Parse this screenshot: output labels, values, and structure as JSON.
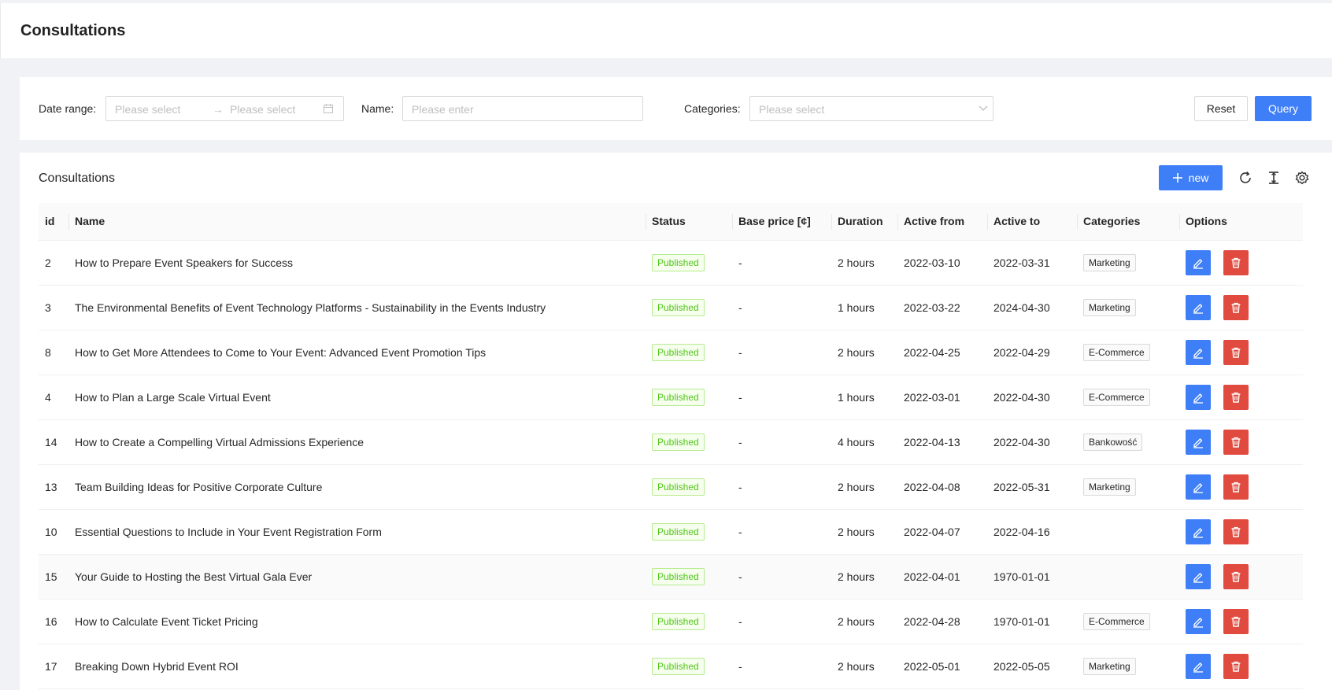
{
  "page": {
    "title": "Consultations"
  },
  "filters": {
    "date_label": "Date range",
    "date_start_placeholder": "Please select",
    "date_end_placeholder": "Please select",
    "name_label": "Name",
    "name_placeholder": "Please enter",
    "categories_label": "Categories",
    "categories_placeholder": "Please select",
    "reset_label": "Reset",
    "query_label": "Query"
  },
  "table": {
    "title": "Consultations",
    "new_label": "new",
    "columns": [
      "id",
      "Name",
      "Status",
      "Base price [¢]",
      "Duration",
      "Active from",
      "Active to",
      "Categories",
      "Options"
    ],
    "rows": [
      {
        "id": "2",
        "name": "How to Prepare Event Speakers for Success",
        "status": "Published",
        "price": "-",
        "duration": "2 hours",
        "from": "2022-03-10",
        "to": "2022-03-31",
        "category": "Marketing"
      },
      {
        "id": "3",
        "name": "The Environmental Benefits of Event Technology Platforms - Sustainability in the Events Industry",
        "status": "Published",
        "price": "-",
        "duration": "1 hours",
        "from": "2022-03-22",
        "to": "2024-04-30",
        "category": "Marketing"
      },
      {
        "id": "8",
        "name": "How to Get More Attendees to Come to Your Event: Advanced Event Promotion Tips",
        "status": "Published",
        "price": "-",
        "duration": "2 hours",
        "from": "2022-04-25",
        "to": "2022-04-29",
        "category": "E-Commerce"
      },
      {
        "id": "4",
        "name": "How to Plan a Large Scale Virtual Event",
        "status": "Published",
        "price": "-",
        "duration": "1 hours",
        "from": "2022-03-01",
        "to": "2022-04-30",
        "category": "E-Commerce"
      },
      {
        "id": "14",
        "name": "How to Create a Compelling Virtual Admissions Experience",
        "status": "Published",
        "price": "-",
        "duration": "4 hours",
        "from": "2022-04-13",
        "to": "2022-04-30",
        "category": "Bankowość"
      },
      {
        "id": "13",
        "name": "Team Building Ideas for Positive Corporate Culture",
        "status": "Published",
        "price": "-",
        "duration": "2 hours",
        "from": "2022-04-08",
        "to": "2022-05-31",
        "category": "Marketing"
      },
      {
        "id": "10",
        "name": "Essential Questions to Include in Your Event Registration Form",
        "status": "Published",
        "price": "-",
        "duration": "2 hours",
        "from": "2022-04-07",
        "to": "2022-04-16",
        "category": ""
      },
      {
        "id": "15",
        "name": "Your Guide to Hosting the Best Virtual Gala Ever",
        "status": "Published",
        "price": "-",
        "duration": "2 hours",
        "from": "2022-04-01",
        "to": "1970-01-01",
        "category": ""
      },
      {
        "id": "16",
        "name": "How to Calculate Event Ticket Pricing",
        "status": "Published",
        "price": "-",
        "duration": "2 hours",
        "from": "2022-04-28",
        "to": "1970-01-01",
        "category": "E-Commerce"
      },
      {
        "id": "17",
        "name": "Breaking Down Hybrid Event ROI",
        "status": "Published",
        "price": "-",
        "duration": "2 hours",
        "from": "2022-05-01",
        "to": "2022-05-05",
        "category": "Marketing"
      }
    ]
  },
  "colors": {
    "primary": "#3e7ef7",
    "danger": "#e04a3f",
    "success": "#52c41a"
  },
  "icons": [
    "calendar-icon",
    "chevron-down-icon",
    "plus-icon",
    "reload-icon",
    "column-height-icon",
    "settings-icon",
    "edit-icon",
    "delete-icon"
  ]
}
